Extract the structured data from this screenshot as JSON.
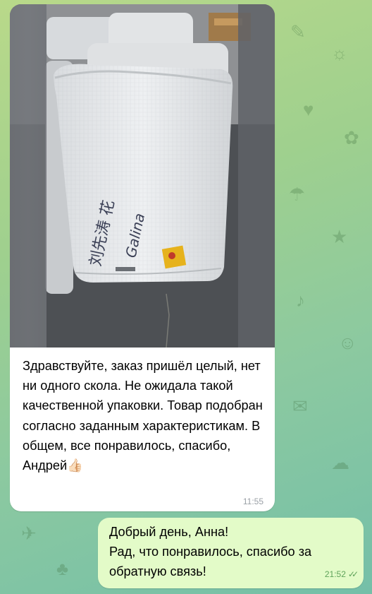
{
  "chat": {
    "incoming": {
      "photo_icon": "photo-image",
      "photo_handwriting": "刘先涛 花  Galina",
      "text": "Здравствуйте, заказ пришёл целый, нет ни одного скола. Не ожидала такой качественной упаковки. Товар подобран согласно заданным характеристикам. В общем, все понравилось, спасибо, Андрей",
      "emoji": "👍🏻",
      "time": "11:55"
    },
    "outgoing": {
      "text": "Добрый день, Анна!\nРад, что понравилось, спасибо за обратную связь!",
      "time": "21:52",
      "status_icon": "double-check-icon"
    }
  },
  "colors": {
    "incoming_bubble": "#ffffff",
    "outgoing_bubble": "#e3fbc8",
    "read_check": "#5fa35a"
  }
}
